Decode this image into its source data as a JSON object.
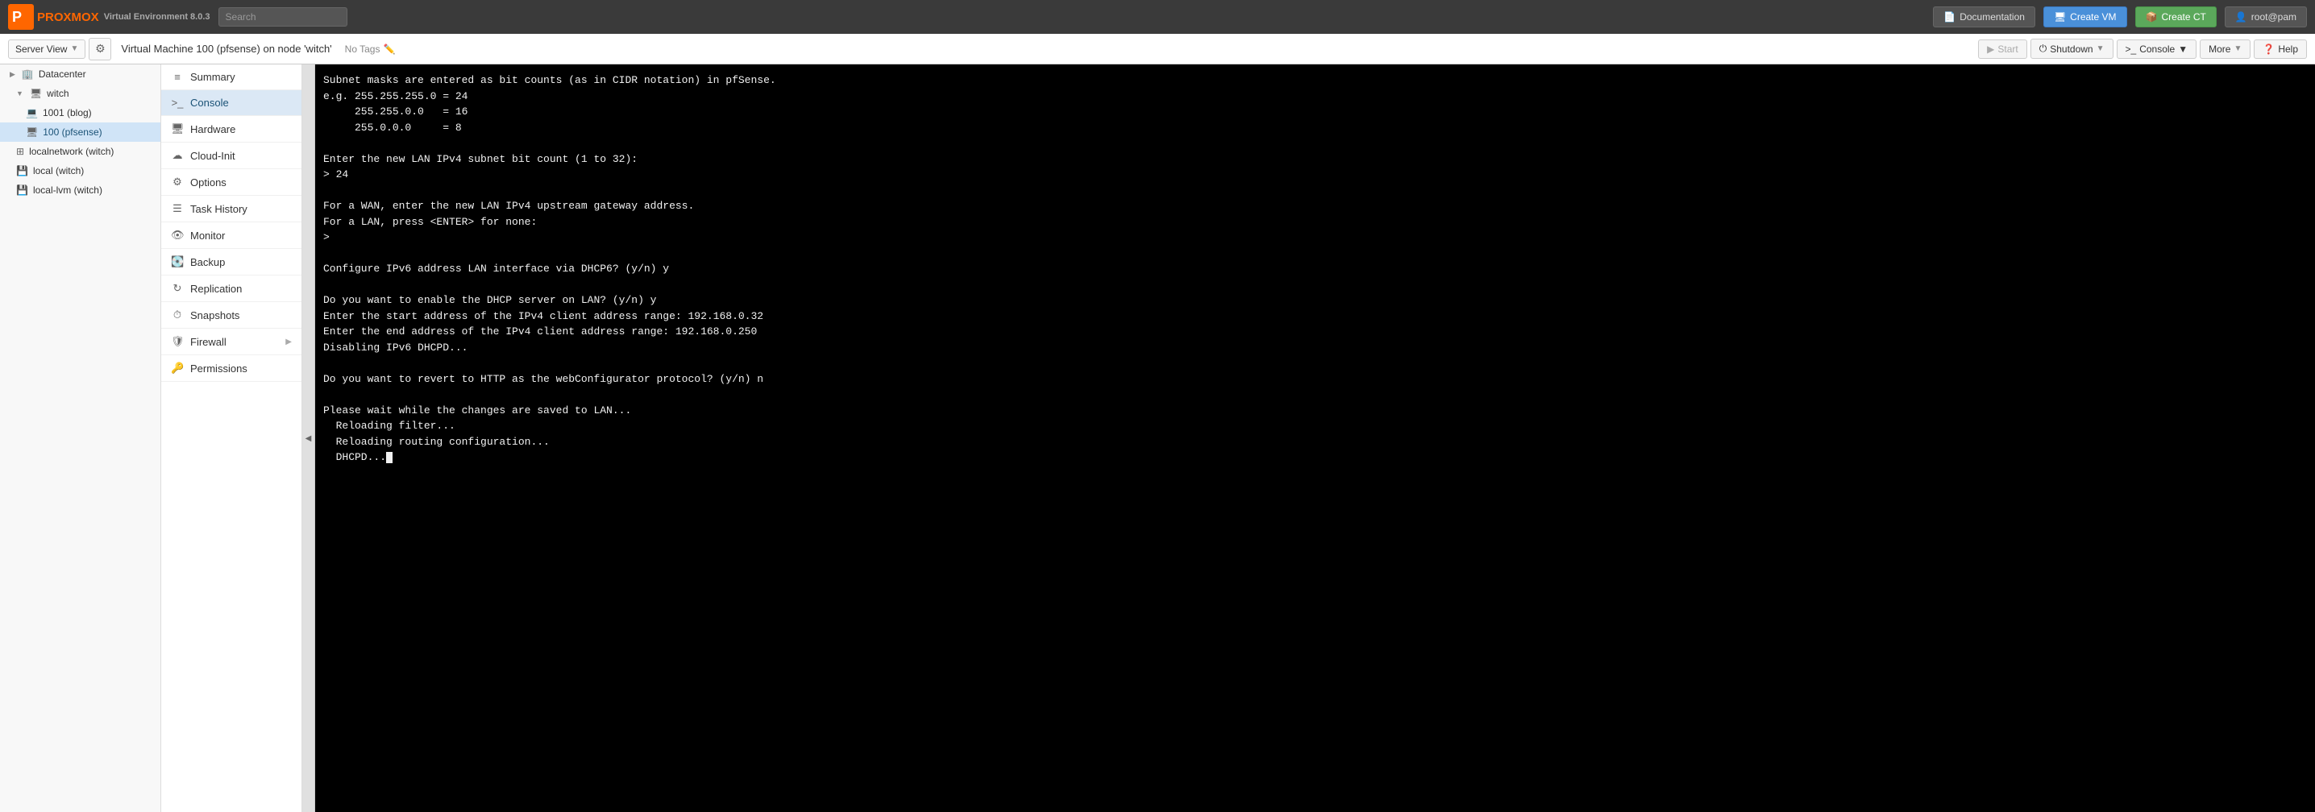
{
  "app": {
    "logo_text": "PROXMOX",
    "env_text": "Virtual Environment 8.0.3",
    "search_placeholder": "Search"
  },
  "topbar": {
    "doc_label": "Documentation",
    "create_vm_label": "Create VM",
    "create_ct_label": "Create CT",
    "user_label": "root@pam"
  },
  "secondbar": {
    "server_view_label": "Server View",
    "vm_title": "Virtual Machine 100 (pfsense) on node 'witch'",
    "no_tags_label": "No Tags",
    "start_label": "Start",
    "shutdown_label": "Shutdown",
    "console_label": "Console",
    "more_label": "More",
    "help_label": "Help"
  },
  "tree": {
    "items": [
      {
        "label": "Datacenter",
        "indent": 0,
        "icon": "🏢",
        "active": false
      },
      {
        "label": "witch",
        "indent": 1,
        "icon": "▼",
        "active": false
      },
      {
        "label": "1001 (blog)",
        "indent": 2,
        "icon": "💻",
        "active": false
      },
      {
        "label": "100 (pfsense)",
        "indent": 2,
        "icon": "🖥",
        "active": true
      },
      {
        "label": "localnetwork (witch)",
        "indent": 1,
        "icon": "⊞",
        "active": false
      },
      {
        "label": "local (witch)",
        "indent": 1,
        "icon": "💾",
        "active": false
      },
      {
        "label": "local-lvm (witch)",
        "indent": 1,
        "icon": "💾",
        "active": false
      }
    ]
  },
  "nav": {
    "items": [
      {
        "label": "Summary",
        "icon": "≡",
        "active": false,
        "arrow": false
      },
      {
        "label": "Console",
        "icon": ">_",
        "active": true,
        "arrow": false
      },
      {
        "label": "Hardware",
        "icon": "🖥",
        "active": false,
        "arrow": false
      },
      {
        "label": "Cloud-Init",
        "icon": "☁",
        "active": false,
        "arrow": false
      },
      {
        "label": "Options",
        "icon": "⚙",
        "active": false,
        "arrow": false
      },
      {
        "label": "Task History",
        "icon": "☰",
        "active": false,
        "arrow": false
      },
      {
        "label": "Monitor",
        "icon": "👁",
        "active": false,
        "arrow": false
      },
      {
        "label": "Backup",
        "icon": "💽",
        "active": false,
        "arrow": false
      },
      {
        "label": "Replication",
        "icon": "↻",
        "active": false,
        "arrow": false
      },
      {
        "label": "Snapshots",
        "icon": "⏱",
        "active": false,
        "arrow": false
      },
      {
        "label": "Firewall",
        "icon": "🛡",
        "active": false,
        "arrow": true
      },
      {
        "label": "Permissions",
        "icon": "🔑",
        "active": false,
        "arrow": false
      }
    ]
  },
  "console": {
    "lines": [
      "Subnet masks are entered as bit counts (as in CIDR notation) in pfSense.",
      "e.g. 255.255.255.0 = 24",
      "     255.255.0.0   = 16",
      "     255.0.0.0     = 8",
      "",
      "Enter the new LAN IPv4 subnet bit count (1 to 32):",
      "> 24",
      "",
      "For a WAN, enter the new LAN IPv4 upstream gateway address.",
      "For a LAN, press <ENTER> for none:",
      ">",
      "",
      "Configure IPv6 address LAN interface via DHCP6? (y/n) y",
      "",
      "Do you want to enable the DHCP server on LAN? (y/n) y",
      "Enter the start address of the IPv4 client address range: 192.168.0.32",
      "Enter the end address of the IPv4 client address range: 192.168.0.250",
      "Disabling IPv6 DHCPD...",
      "",
      "Do you want to revert to HTTP as the webConfigurator protocol? (y/n) n",
      "",
      "Please wait while the changes are saved to LAN...",
      "  Reloading filter...",
      "  Reloading routing configuration...",
      "  DHCPD..."
    ]
  }
}
